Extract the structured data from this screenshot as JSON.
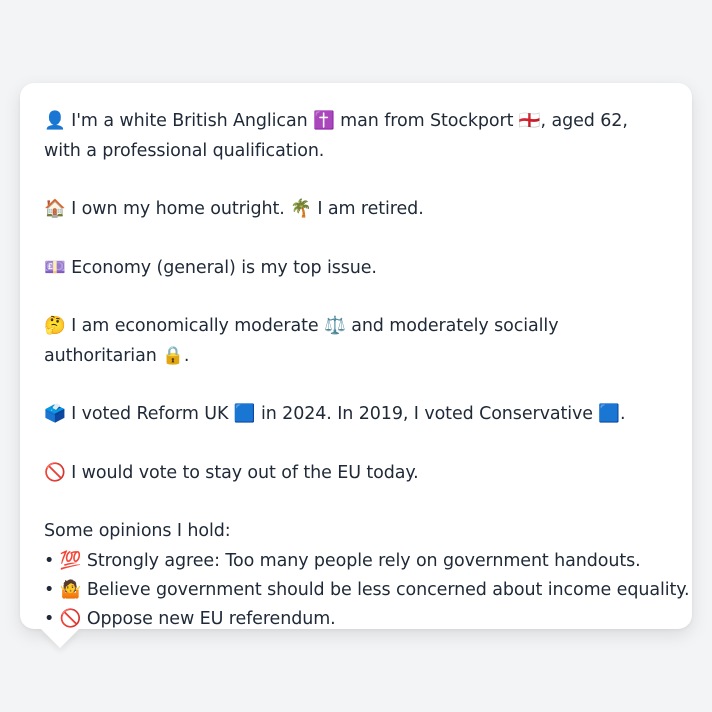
{
  "profile": {
    "line_identity": "👤 I'm a white British Anglican ✝️ man from Stockport 🏴󠁧󠁢󠁥󠁮󠁧󠁿, aged 62, with a professional qualification.",
    "line_home": "🏠 I own my home outright. 🌴 I am retired.",
    "line_issue": "💷 Economy (general) is my top issue.",
    "line_ideology": "🤔 I am economically moderate ⚖️ and moderately socially authoritarian 🔒.",
    "line_vote": "🗳️ I voted Reform UK 🟦 in 2024. In 2019, I voted Conservative 🟦.",
    "line_eu": "🚫 I would vote to stay out of the EU today.",
    "opinions_heading": "Some opinions I hold:",
    "opinions": [
      "• 💯 Strongly agree: Too many people rely on government handouts.",
      "• 🤷 Believe government should be less concerned about income equality.",
      "• 🚫 Oppose new EU referendum."
    ]
  }
}
